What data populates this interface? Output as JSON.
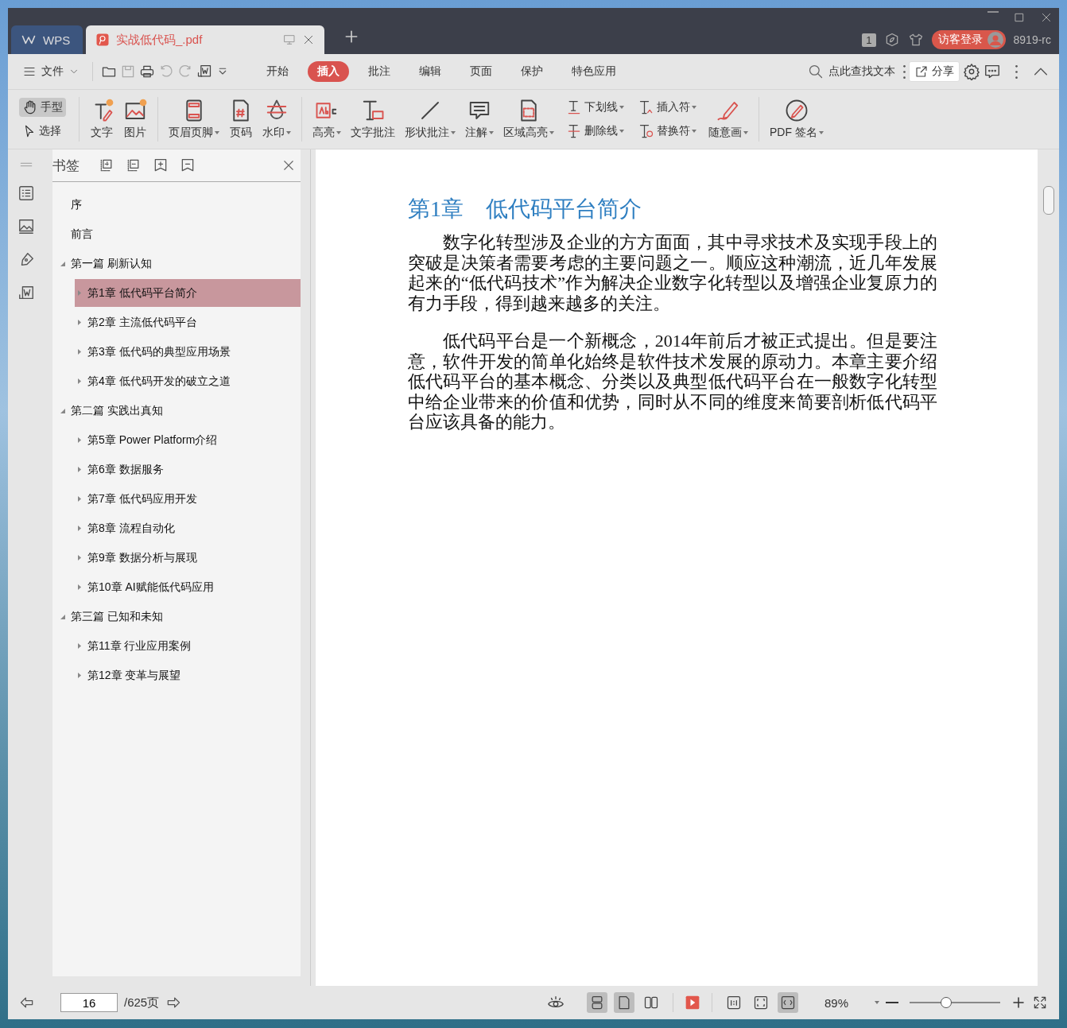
{
  "titlebar": {
    "tabs": [
      {
        "label": "WPS",
        "kind": "home",
        "selected": false
      },
      {
        "label": "实战低代码_.pdf",
        "kind": "doc",
        "selected": true
      }
    ],
    "page_badge": "1",
    "login": "访客登录",
    "version": "8919-rc"
  },
  "menu": {
    "file": "文件",
    "tabs": [
      {
        "label": "开始",
        "selected": false
      },
      {
        "label": "插入",
        "selected": true
      },
      {
        "label": "批注",
        "selected": false
      },
      {
        "label": "编辑",
        "selected": false
      },
      {
        "label": "页面",
        "selected": false
      },
      {
        "label": "保护",
        "selected": false
      },
      {
        "label": "特色应用",
        "selected": false
      }
    ],
    "search": "点此查找文本",
    "share": "分享"
  },
  "ribbon": {
    "hand": {
      "label": "手型",
      "selected": true
    },
    "select": {
      "label": "选择",
      "selected": false
    },
    "groups": [
      [
        {
          "kind": "big",
          "label": "文字",
          "dropdown": false
        },
        {
          "kind": "big",
          "label": "图片",
          "dropdown": false
        }
      ],
      [
        {
          "kind": "big",
          "label": "页眉页脚",
          "dropdown": true
        },
        {
          "kind": "big",
          "label": "页码",
          "dropdown": false
        },
        {
          "kind": "big",
          "label": "水印",
          "dropdown": true
        }
      ],
      [
        {
          "kind": "big",
          "label": "高亮",
          "dropdown": true
        },
        {
          "kind": "big",
          "label": "文字批注",
          "dropdown": false
        },
        {
          "kind": "big",
          "label": "形状批注",
          "dropdown": true
        },
        {
          "kind": "big",
          "label": "注解",
          "dropdown": true
        },
        {
          "kind": "big",
          "label": "区域高亮",
          "dropdown": true
        },
        {
          "kind": "pair",
          "items": [
            {
              "label": "下划线",
              "dropdown": true
            },
            {
              "label": "删除线",
              "dropdown": true
            }
          ]
        },
        {
          "kind": "pair",
          "items": [
            {
              "label": "插入符",
              "dropdown": true
            },
            {
              "label": "替换符",
              "dropdown": true
            }
          ]
        },
        {
          "kind": "big",
          "label": "随意画",
          "dropdown": true
        }
      ],
      [
        {
          "kind": "big",
          "label": "PDF 签名",
          "dropdown": true
        }
      ]
    ]
  },
  "bookmarks": {
    "title": "书签",
    "items": [
      {
        "label": "序",
        "selected": false
      },
      {
        "label": "前言",
        "selected": false
      },
      {
        "label": "第一篇 刷新认知",
        "selected": false,
        "expanded": true,
        "children": [
          {
            "label": "第1章 低代码平台简介",
            "selected": true,
            "expanded": false
          },
          {
            "label": "第2章 主流低代码平台",
            "selected": false,
            "expanded": false
          },
          {
            "label": "第3章 低代码的典型应用场景",
            "selected": false,
            "expanded": false
          },
          {
            "label": "第4章 低代码开发的破立之道",
            "selected": false,
            "expanded": false
          }
        ]
      },
      {
        "label": "第二篇 实践出真知",
        "selected": false,
        "expanded": true,
        "children": [
          {
            "label": "第5章 Power Platform介绍",
            "selected": false,
            "expanded": false
          },
          {
            "label": "第6章 数据服务",
            "selected": false,
            "expanded": false
          },
          {
            "label": "第7章 低代码应用开发",
            "selected": false,
            "expanded": false
          },
          {
            "label": "第8章 流程自动化",
            "selected": false,
            "expanded": false
          },
          {
            "label": "第9章 数据分析与展现",
            "selected": false,
            "expanded": false
          },
          {
            "label": "第10章 AI赋能低代码应用",
            "selected": false,
            "expanded": false
          }
        ]
      },
      {
        "label": "第三篇 已知和未知",
        "selected": false,
        "expanded": true,
        "children": [
          {
            "label": "第11章 行业应用案例",
            "selected": false,
            "expanded": false
          },
          {
            "label": "第12章 变革与展望",
            "selected": false,
            "expanded": false
          }
        ]
      }
    ]
  },
  "document": {
    "heading": "第1章　低代码平台简介",
    "paragraphs": [
      "数字化转型涉及企业的方方面面，其中寻求技术及实现手段上的突破是决策者需要考虑的主要问题之一。顺应这种潮流，近几年发展起来的“低代码技术”作为解决企业数字化转型以及增强企业复原力的有力手段，得到越来越多的关注。",
      "低代码平台是一个新概念，2014年前后才被正式提出。但是要注意，软件开发的简单化始终是软件技术发展的原动力。本章主要介绍低代码平台的基本概念、分类以及典型低代码平台在一般数字化转型中给企业带来的价值和优势，同时从不同的维度来简要剖析低代码平台应该具备的能力。"
    ]
  },
  "status_bar": {
    "page": "16",
    "total": "/625页",
    "views": [
      {
        "selected": true
      },
      {
        "selected": true
      },
      {
        "selected": false
      }
    ],
    "fits": [
      {
        "selected": false
      },
      {
        "selected": false
      },
      {
        "selected": true
      }
    ],
    "zoom": "89%",
    "zoom_slider": {
      "level": 0.4
    }
  }
}
